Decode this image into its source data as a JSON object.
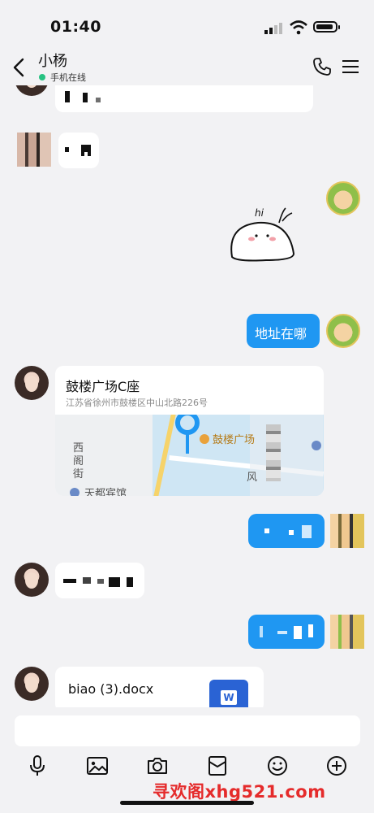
{
  "status_bar": {
    "time": "01:40"
  },
  "header": {
    "title": "小杨",
    "status": "手机在线"
  },
  "messages": {
    "location": {
      "name": "鼓楼广场C座",
      "address": "江苏省徐州市鼓楼区中山北路226号",
      "map_labels": {
        "poi": "鼓楼广场",
        "street_west": "西阁街",
        "hotel": "天都宾馆",
        "feng": "风"
      }
    },
    "sent_text": "地址在哪",
    "file": {
      "name": "biao (3).docx",
      "icon_letter": "W"
    }
  },
  "input": {
    "placeholder": ""
  },
  "toolbar": {
    "icons": [
      "microphone-icon",
      "image-icon",
      "camera-icon",
      "red-packet-icon",
      "emoji-icon",
      "plus-icon"
    ]
  },
  "watermark": "寻欢阁xhg521.com",
  "colors": {
    "accent": "#1f97f2",
    "background": "#f2f2f4",
    "online": "#26c281",
    "word": "#2a63d4"
  }
}
